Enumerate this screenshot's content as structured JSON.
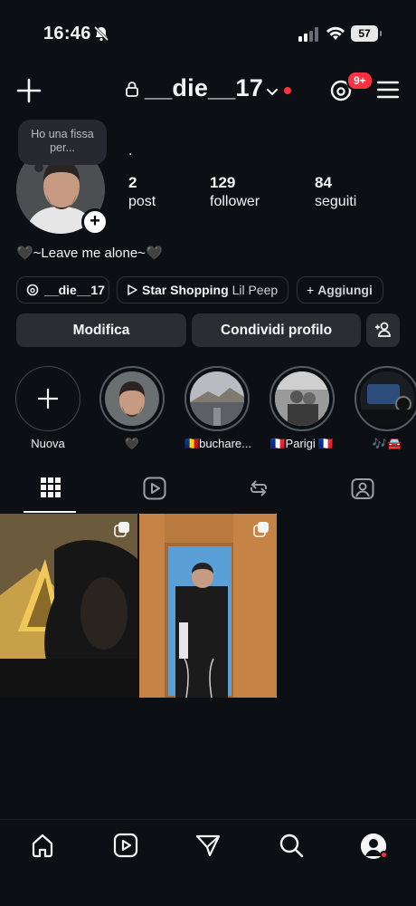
{
  "status": {
    "time": "16:46",
    "battery": "57"
  },
  "header": {
    "username": "__die__17",
    "badge": "9+"
  },
  "profile": {
    "note": "Ho una fissa per...",
    "name_line": ".",
    "stats": [
      {
        "value": "2",
        "label": "post"
      },
      {
        "value": "129",
        "label": "follower"
      },
      {
        "value": "84",
        "label": "seguiti"
      }
    ],
    "bio": "🖤~Leave me alone~🖤"
  },
  "chips": {
    "threads": "__die__17",
    "music_title": "Star Shopping",
    "music_artist": "Lil Peep",
    "add": "Aggiungi"
  },
  "buttons": {
    "edit": "Modifica",
    "share": "Condividi profilo"
  },
  "highlights": [
    {
      "label": "Nuova"
    },
    {
      "label": "🖤"
    },
    {
      "label": "🇷🇴buchare..."
    },
    {
      "label": "🇫🇷Parigi 🇫🇷"
    },
    {
      "label": "🎶🚘"
    }
  ],
  "colors": {
    "background": "#0c1014",
    "accent": "#ff3040",
    "button": "#2a2e33"
  }
}
